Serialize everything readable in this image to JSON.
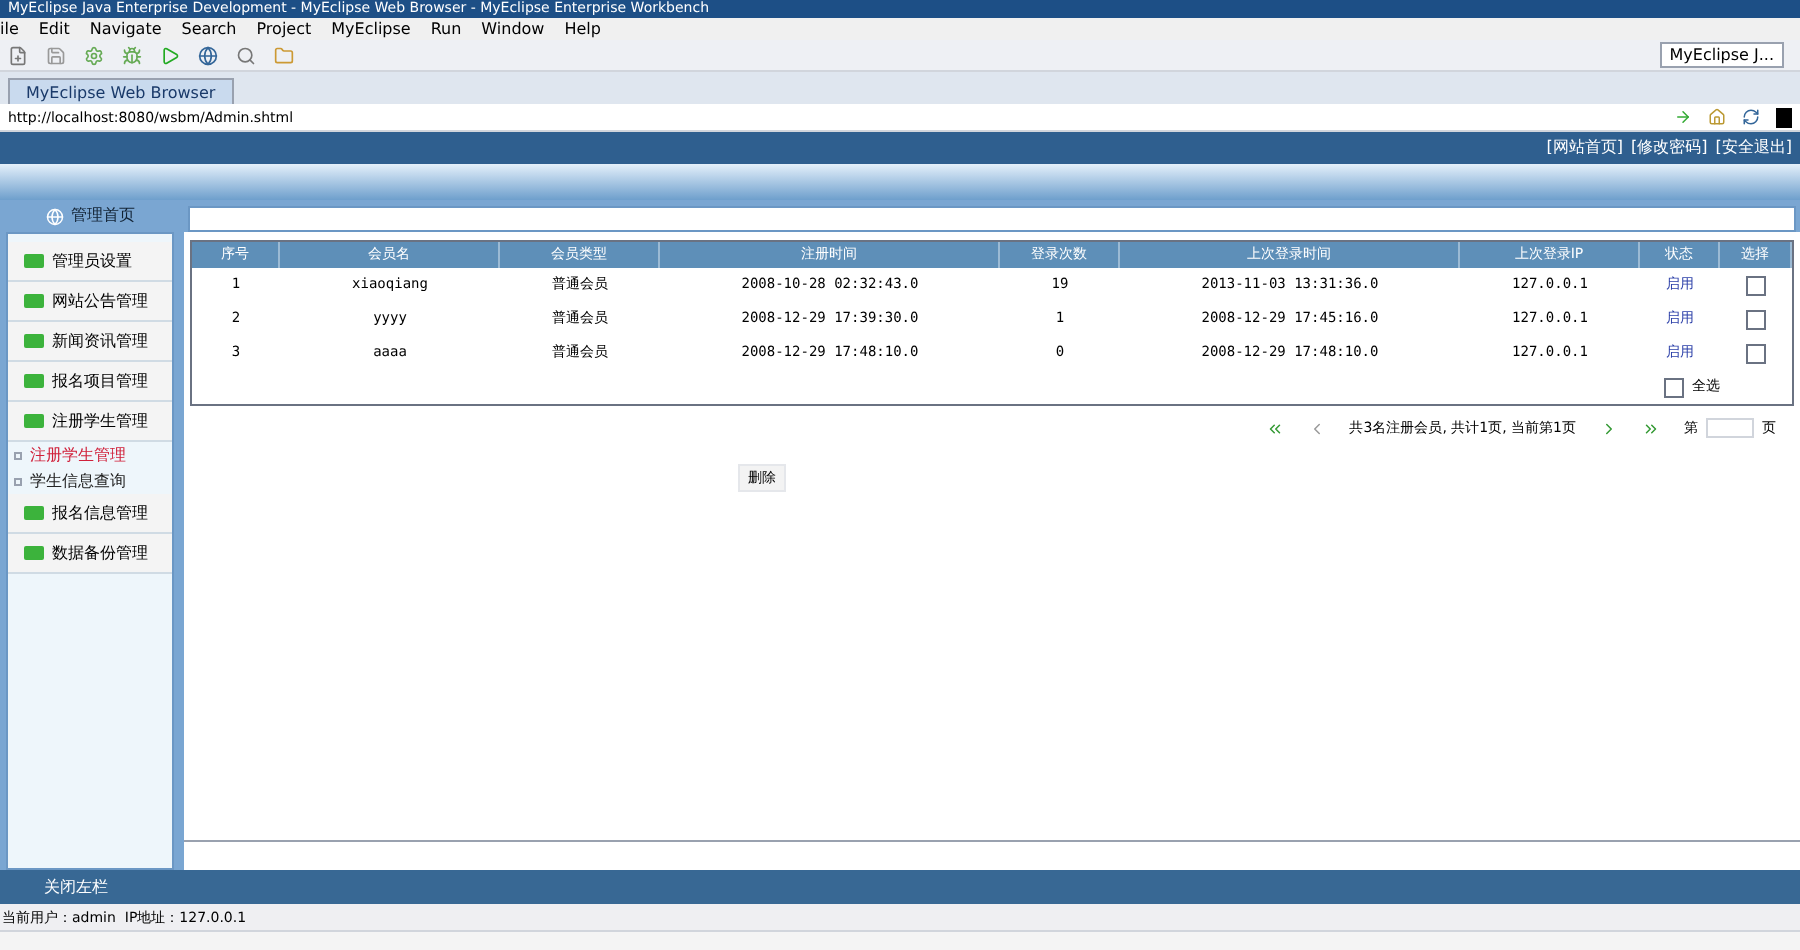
{
  "window": {
    "title": "MyEclipse Java Enterprise Development - MyEclipse Web Browser - MyEclipse Enterprise Workbench"
  },
  "menu_bar": [
    "ile",
    "Edit",
    "Navigate",
    "Search",
    "Project",
    "MyEclipse",
    "Run",
    "Window",
    "Help"
  ],
  "perspective_button": "MyEclipse J...",
  "editor_tab": {
    "label": "MyEclipse Web Browser",
    "selected": true
  },
  "address_bar": {
    "value": "http://localhost:8080/wsbm/Admin.shtml"
  },
  "header": {
    "links": [
      "[网站首页]",
      "[修改密码]",
      "[安全退出]"
    ]
  },
  "sidebar": {
    "title": "管理首页",
    "items": [
      {
        "kind": "menu",
        "label": "管理员设置"
      },
      {
        "kind": "menu",
        "label": "网站公告管理"
      },
      {
        "kind": "menu",
        "label": "新闻资讯管理"
      },
      {
        "kind": "menu",
        "label": "报名项目管理"
      },
      {
        "kind": "menu",
        "label": "注册学生管理"
      },
      {
        "kind": "sub",
        "label": "注册学生管理",
        "selected": true
      },
      {
        "kind": "sub",
        "label": "学生信息查询",
        "selected": false
      },
      {
        "kind": "menu",
        "label": "报名信息管理"
      },
      {
        "kind": "menu",
        "label": "数据备份管理"
      }
    ]
  },
  "table": {
    "columns": [
      "序号",
      "会员名",
      "会员类型",
      "注册时间",
      "登录次数",
      "上次登录时间",
      "上次登录IP",
      "状态",
      "选择"
    ],
    "rows": [
      {
        "cells": [
          "1",
          "xiaoqiang",
          "普通会员",
          "2008-10-28 02:32:43.0",
          "19",
          "2013-11-03 13:31:36.0",
          "127.0.0.1"
        ],
        "status": "启用",
        "checked": false
      },
      {
        "cells": [
          "2",
          "yyyy",
          "普通会员",
          "2008-12-29 17:39:30.0",
          "1",
          "2008-12-29 17:45:16.0",
          "127.0.0.1"
        ],
        "status": "启用",
        "checked": false
      },
      {
        "cells": [
          "3",
          "aaaa",
          "普通会员",
          "2008-12-29 17:48:10.0",
          "0",
          "2008-12-29 17:48:10.0",
          "127.0.0.1"
        ],
        "status": "启用",
        "checked": false
      }
    ],
    "select_all": {
      "label": "全选",
      "checked": false
    }
  },
  "pagination": {
    "summary": "共3名注册会员, 共计1页, 当前第1页",
    "page_prefix": "第",
    "page_suffix": "页"
  },
  "delete_button": "删除",
  "footer": {
    "toggle": "关闭左栏"
  },
  "status_bar": "当前用户：admin  IP地址：127.0.0.1"
}
